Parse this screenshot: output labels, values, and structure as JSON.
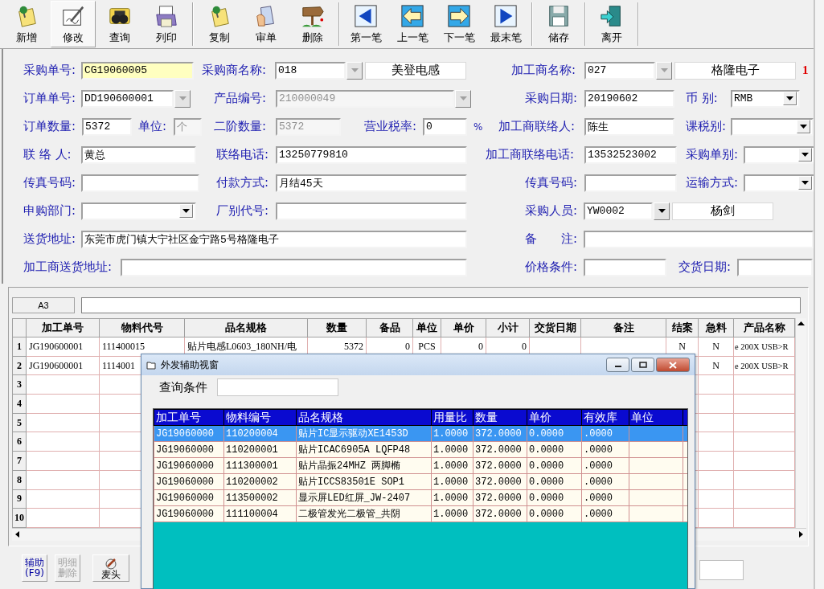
{
  "toolbar": {
    "groups": [
      {
        "buttons": [
          {
            "label": "新增",
            "kind": "note",
            "selected": false
          },
          {
            "label": "修改",
            "kind": "edit",
            "selected": true
          },
          {
            "label": "查询",
            "kind": "search",
            "selected": false
          },
          {
            "label": "列印",
            "kind": "print",
            "selected": false
          }
        ]
      },
      {
        "buttons": [
          {
            "label": "复制",
            "kind": "note",
            "selected": false
          },
          {
            "label": "审单",
            "kind": "approve",
            "selected": false
          },
          {
            "label": "删除",
            "kind": "delete",
            "selected": false
          }
        ]
      },
      {
        "buttons": [
          {
            "label": "第一笔",
            "kind": "first",
            "selected": false
          },
          {
            "label": "上一笔",
            "kind": "prev",
            "selected": false
          },
          {
            "label": "下一笔",
            "kind": "next",
            "selected": false
          },
          {
            "label": "最末笔",
            "kind": "last",
            "selected": false
          }
        ]
      },
      {
        "buttons": [
          {
            "label": "储存",
            "kind": "save",
            "selected": false
          }
        ]
      },
      {
        "buttons": [
          {
            "label": "离开",
            "kind": "exit",
            "selected": false
          }
        ]
      }
    ]
  },
  "form": {
    "rows": [
      {
        "fields": [
          {
            "label": "采购单号:",
            "kind": "text",
            "value": "CG19060005",
            "focused": true,
            "disabled": false
          },
          {
            "label": "采购商名称:",
            "kind": "lookup",
            "value": "018",
            "name": "美登电感",
            "focused": false,
            "disabled": false,
            "button_disabled": true
          },
          {
            "label": "加工商名称:",
            "kind": "lookup",
            "value": "027",
            "name": "格隆电子",
            "focused": false,
            "disabled": false,
            "button_disabled": true,
            "badge": "1"
          }
        ]
      },
      {
        "fields": [
          {
            "label": "订单单号:",
            "kind": "combo",
            "value": "DD190600001",
            "focused": false,
            "disabled": false,
            "button_disabled": true
          },
          {
            "label": "产品编号:",
            "kind": "combo",
            "value": "210000049",
            "focused": false,
            "disabled": true,
            "button_disabled": true
          },
          {
            "label": "采购日期:",
            "kind": "text",
            "value": "20190602",
            "focused": false,
            "disabled": false
          },
          {
            "label": "币 别:",
            "kind": "select",
            "value": "RMB",
            "focused": false,
            "disabled": false
          }
        ]
      },
      {
        "fields": [
          {
            "label": "订单数量:",
            "kind": "text",
            "value": "5372",
            "focused": false,
            "disabled": false
          },
          {
            "label": "单位:",
            "kind": "text",
            "value": "个",
            "focused": false,
            "disabled": true
          },
          {
            "label": "二阶数量:",
            "kind": "text",
            "value": "5372",
            "focused": false,
            "disabled": true
          },
          {
            "label": "营业税率:",
            "kind": "number",
            "value": "0",
            "unit": "%",
            "focused": false,
            "disabled": false
          },
          {
            "label": "加工商联络人:",
            "kind": "text",
            "value": "陈生",
            "focused": false,
            "disabled": false
          },
          {
            "label": "课税别:",
            "kind": "select",
            "focused": false
          }
        ]
      },
      {
        "fields": [
          {
            "label": "联 络 人:",
            "kind": "text",
            "value": "黄总",
            "focused": false,
            "disabled": false
          },
          {
            "label": "联络电话:",
            "kind": "text",
            "value": "13250779810",
            "focused": false,
            "disabled": false
          },
          {
            "label": "加工商联络电话:",
            "kind": "text",
            "value": "13532523002",
            "focused": false,
            "disabled": false
          },
          {
            "label": "采购单别:",
            "kind": "select",
            "focused": false
          }
        ]
      },
      {
        "fields": [
          {
            "label": "传真号码:",
            "kind": "text",
            "focused": false
          },
          {
            "label": "付款方式:",
            "kind": "text",
            "value": "月结45天",
            "focused": false,
            "disabled": false
          },
          {
            "label": "传真号码:",
            "kind": "text",
            "focused": false
          },
          {
            "label": "运输方式:",
            "kind": "select",
            "focused": false
          }
        ]
      },
      {
        "fields": [
          {
            "label": "申购部门:",
            "kind": "select",
            "focused": false
          },
          {
            "label": "厂别代号:",
            "kind": "text",
            "focused": false
          },
          {
            "label": "采购人员:",
            "kind": "lookup",
            "value": "YW0002",
            "name": "杨剑",
            "focused": false,
            "disabled": false,
            "button_disabled": false
          }
        ]
      },
      {
        "fields": [
          {
            "label": "送货地址:",
            "kind": "text",
            "value": "东莞市虎门镇大宁社区金宁路5号格隆电子",
            "focused": false,
            "disabled": false
          },
          {
            "label": "备　　注:",
            "kind": "text",
            "focused": false
          }
        ]
      },
      {
        "fields": [
          {
            "label": "加工商送货地址:",
            "kind": "text",
            "focused": false
          },
          {
            "label": "价格条件:",
            "kind": "text",
            "focused": false
          },
          {
            "label": "交货日期:",
            "kind": "text",
            "focused": false
          }
        ]
      }
    ]
  },
  "grid": {
    "cell_ref": "A3",
    "columns": [
      "加工单号",
      "物料代号",
      "品名规格",
      "数量",
      "备品",
      "单位",
      "单价",
      "小计",
      "交货日期",
      "备注",
      "结案",
      "急料",
      "产品名称"
    ],
    "rows": [
      {
        "number": "1",
        "cells": [
          "JG190600001",
          "111400015",
          "贴片电感L0603_180NH/电",
          "5372",
          "0",
          "PCS",
          "0",
          "0",
          null,
          null,
          "N",
          "N",
          "e 200X USB>R"
        ]
      },
      {
        "number": "2",
        "cells": [
          "JG190600001",
          "1114001",
          null,
          null,
          null,
          null,
          null,
          null,
          null,
          null,
          null,
          "N",
          "e 200X USB>R"
        ]
      },
      {
        "number": "3"
      },
      {
        "number": "4"
      },
      {
        "number": "5"
      },
      {
        "number": "6"
      },
      {
        "number": "7"
      },
      {
        "number": "8"
      },
      {
        "number": "9"
      },
      {
        "number": "10"
      }
    ]
  },
  "popup": {
    "title": "外发辅助视窗",
    "query_label": "查询条件",
    "columns": [
      "加工单号",
      "物料编号",
      "品名规格",
      "用量比",
      "数量",
      "单价",
      "有效库",
      "单位"
    ],
    "rows": [
      {
        "selected": true,
        "cells": [
          "JG19060000",
          "110200004",
          "贴片IC显示驱动XE1453D",
          "1.0000",
          "372.0000",
          "0.0000",
          ".0000"
        ]
      },
      {
        "selected": false,
        "cells": [
          "JG19060000",
          "110200001",
          "贴片ICAC6905A LQFP48",
          "1.0000",
          "372.0000",
          "0.0000",
          ".0000"
        ]
      },
      {
        "selected": false,
        "cells": [
          "JG19060000",
          "111300001",
          "贴片晶振24MHZ 两脚椭",
          "1.0000",
          "372.0000",
          "0.0000",
          ".0000"
        ]
      },
      {
        "selected": false,
        "cells": [
          "JG19060000",
          "110200002",
          "贴片ICCS83501E  SOP1",
          "1.0000",
          "372.0000",
          "0.0000",
          ".0000"
        ]
      },
      {
        "selected": false,
        "cells": [
          "JG19060000",
          "113500002",
          "显示屏LED红屏_JW-2407",
          "1.0000",
          "372.0000",
          "0.0000",
          ".0000"
        ]
      },
      {
        "selected": false,
        "cells": [
          "JG19060000",
          "111100004",
          "二极管发光二极管_共阴",
          "1.0000",
          "372.0000",
          "0.0000",
          ".0000"
        ]
      }
    ]
  },
  "bottom": {
    "buttons": [
      {
        "lines": [
          "辅助",
          "(F9)"
        ],
        "kind": "text",
        "disabled": false
      },
      {
        "lines": [
          "明细",
          "删除"
        ],
        "kind": "text",
        "disabled": true
      },
      {
        "lines": [
          "麦头"
        ],
        "kind": "icon",
        "disabled": false
      }
    ]
  }
}
